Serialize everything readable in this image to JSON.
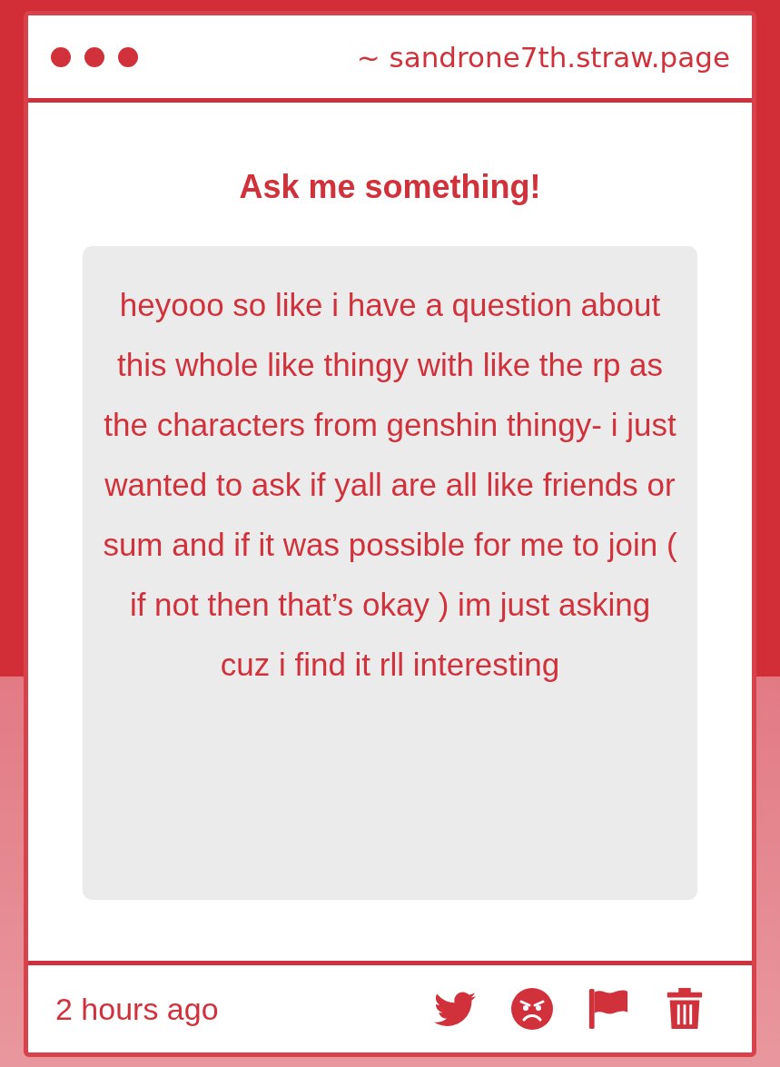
{
  "window": {
    "url": "~ sandrone7th.straw.page"
  },
  "title": "Ask me something!",
  "question": "heyooo so like i have a question about this whole like thingy with like the rp as the characters from genshin thingy- i just wanted to ask if yall are all like friends or sum and if it was possible for me to join ( if not then that’s okay ) im just asking cuz i find it rll interesting",
  "footer": {
    "time": "2 hours ago",
    "actions": [
      {
        "kind": "twitter"
      },
      {
        "kind": "angry"
      },
      {
        "kind": "flag"
      },
      {
        "kind": "trash"
      }
    ]
  }
}
